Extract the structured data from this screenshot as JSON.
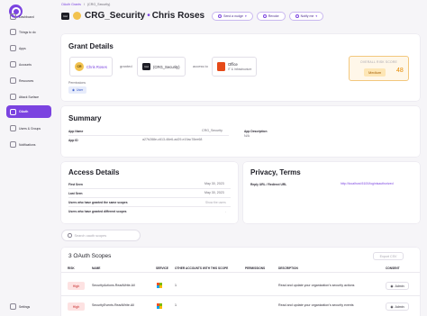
{
  "sidebar": {
    "items": [
      {
        "label": "Dashboard",
        "icon": "dashboard-icon",
        "active": false
      },
      {
        "label": "Things to do",
        "icon": "checklist-icon",
        "active": false
      },
      {
        "label": "Apps",
        "icon": "apps-icon",
        "active": false
      },
      {
        "label": "Accounts",
        "icon": "accounts-icon",
        "active": false
      },
      {
        "label": "Resources",
        "icon": "resources-icon",
        "active": false
      },
      {
        "label": "Attack Surface",
        "icon": "attack-surface-icon",
        "active": false
      },
      {
        "label": "OAuth",
        "icon": "oauth-icon",
        "active": true
      },
      {
        "label": "Users & Groups",
        "icon": "users-icon",
        "active": false
      },
      {
        "label": "Notifications",
        "icon": "bell-icon",
        "active": false
      }
    ],
    "settings_label": "Settings"
  },
  "breadcrumb": {
    "root": "OAuth Grants",
    "separator": "/",
    "current": "(CRG_Security)"
  },
  "header": {
    "gh_badge": "GH",
    "app_name": "CRG_Security",
    "separator": "•",
    "user_name": "Chris Roses",
    "send_nudge": "Send a nudge",
    "revoke": "Revoke",
    "notify_me": "Notify me"
  },
  "grant": {
    "title": "Grant Details",
    "user_initials": "CR",
    "user_name": "Chris Roses",
    "granted_word": "granted",
    "app_badge": "GH",
    "app_name": "(CRG_Security)",
    "access_word": "access to",
    "resource_name": "Office",
    "resource_sub": "IT & Infrastructure",
    "permissions_label": "Permissions",
    "permission_chip": "User",
    "risk_label": "OVERALL RISK SCORE",
    "risk_level": "Medium",
    "risk_score": "48"
  },
  "summary": {
    "title": "Summary",
    "app_name_label": "App Name",
    "app_name_value": "CRG_Security",
    "app_id_label": "App ID",
    "app_id_value": "a27b288e-c613-46e6-ad29-e19ac78ee68",
    "desc_label": "App Description",
    "desc_value": "N/A"
  },
  "access": {
    "title": "Access Details",
    "first_seen_label": "First Seen",
    "first_seen_value": "May 30, 2023",
    "last_seen_label": "Last Seen",
    "last_seen_value": "May 30, 2023",
    "same_scopes_label": "Users who have granted the same scopes",
    "same_scopes_value": "Show the users",
    "diff_scopes_label": "Users who have granted different scopes",
    "diff_scopes_value": "-"
  },
  "privacy": {
    "title": "Privacy, Terms",
    "reply_label": "Reply URL / Redirect URL",
    "reply_value": "http://localhost:5100/loginisauthorized"
  },
  "search": {
    "placeholder": "Search oauth scopes"
  },
  "scopes": {
    "title": "3 OAuth Scopes",
    "export_label": "Export CSV",
    "headers": [
      "RISK",
      "NAME",
      "SERVICE",
      "OTHER ACCOUNTS WITH THIS SCOPE",
      "PERMISSIONS",
      "DESCRIPTION",
      "CONSENT"
    ],
    "rows": [
      {
        "risk": "High",
        "name": "SecurityActions.ReadWrite.All",
        "others": "1",
        "permissions": "",
        "description": "Read and update your organization's security actions",
        "consent": "Admin"
      },
      {
        "risk": "High",
        "name": "SecurityEvents.ReadWrite.All",
        "others": "1",
        "permissions": "",
        "description": "Read and update your organization's security events",
        "consent": "Admin"
      }
    ]
  },
  "colors": {
    "accent": "#7b43e0",
    "risk_medium": "#e58a00",
    "risk_high": "#c62828"
  }
}
